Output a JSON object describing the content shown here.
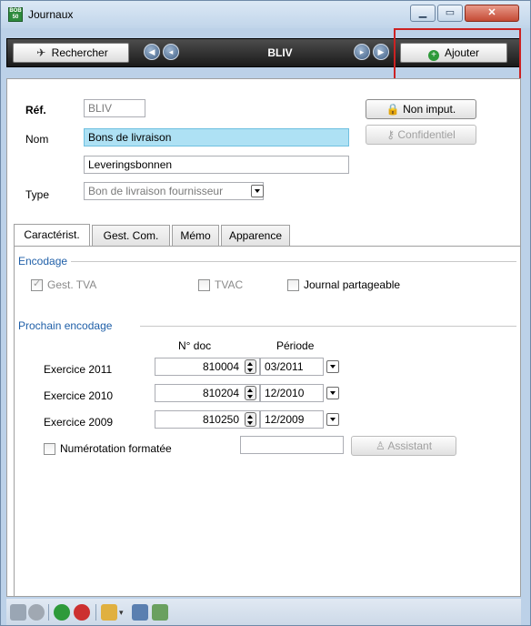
{
  "window": {
    "title": "Journaux",
    "app_icon_text": "BOB\n50",
    "controls": {
      "minimize": "▁",
      "maximize": "▭",
      "close": "✕"
    }
  },
  "toolbar": {
    "search_label": "Rechercher",
    "current_journal": "BLIV",
    "add_label": "Ajouter"
  },
  "form": {
    "ref_label": "Réf.",
    "ref_value": "BLIV",
    "name_label": "Nom",
    "name_value_1": "Bons de livraison",
    "name_value_2": "Leveringsbonnen",
    "type_label": "Type",
    "type_value": "Bon de livraison fournisseur",
    "non_imput_label": "Non imput.",
    "confidentiel_label": "Confidentiel"
  },
  "tabs": [
    {
      "label": "Caractérist."
    },
    {
      "label": "Gest. Com."
    },
    {
      "label": "Mémo"
    },
    {
      "label": "Apparence"
    }
  ],
  "encodage": {
    "title": "Encodage",
    "gest_tva": "Gest. TVA",
    "tvac": "TVAC",
    "partageable": "Journal partageable"
  },
  "prochain": {
    "title": "Prochain encodage",
    "col_doc": "N° doc",
    "col_periode": "Période",
    "rows": [
      {
        "label": "Exercice 2011",
        "doc": "810004",
        "periode": "03/2011"
      },
      {
        "label": "Exercice 2010",
        "doc": "810204",
        "periode": "12/2010"
      },
      {
        "label": "Exercice 2009",
        "doc": "810250",
        "periode": "12/2009"
      }
    ],
    "numerotation_label": "Numérotation formatée",
    "numerotation_value": "",
    "assistant_label": "Assistant"
  },
  "colors": {
    "accent_blue": "#1f5fa8",
    "highlight_red": "#cc2222",
    "toolbar_dark": "#1a1a1a",
    "add_green": "#2e9a3a"
  }
}
